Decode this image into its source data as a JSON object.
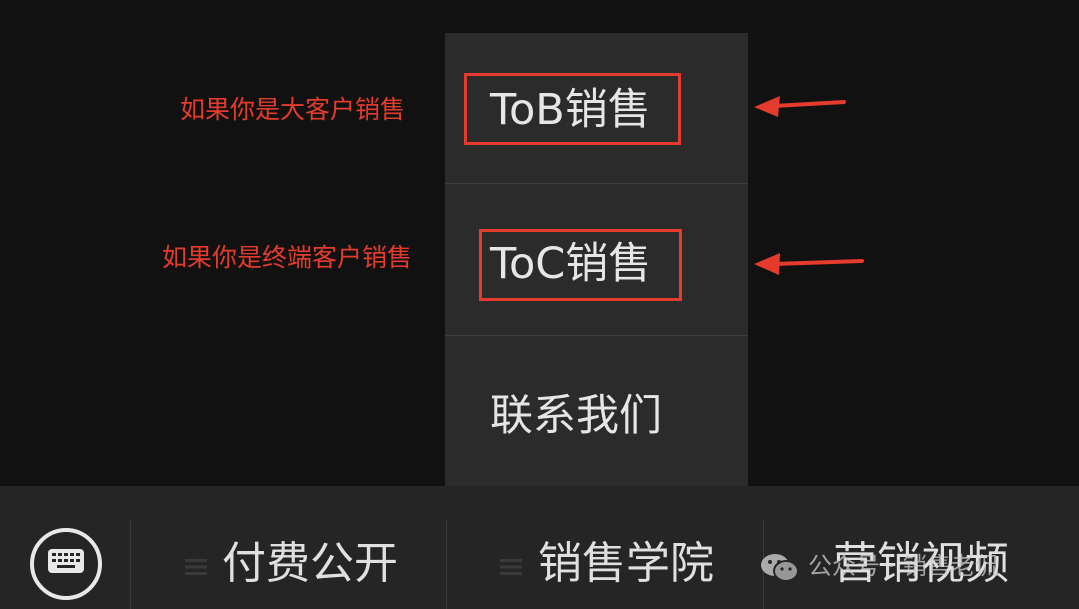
{
  "menu": {
    "items": [
      {
        "label": "ToB销售"
      },
      {
        "label": "ToC销售"
      },
      {
        "label": "联系我们"
      }
    ]
  },
  "annotations": [
    {
      "text": "如果你是大客户销售"
    },
    {
      "text": "如果你是终端客户销售"
    }
  ],
  "bottom_bar": {
    "keyboard_icon": "keyboard-icon",
    "tabs": [
      {
        "label": "付费公开"
      },
      {
        "label": "销售学院"
      },
      {
        "label": "营销视频"
      }
    ]
  },
  "watermark": {
    "text": "公众号 · 销售老侃"
  },
  "colors": {
    "background": "#111111",
    "menu_bg": "#2b2b2b",
    "bottom_bar_bg": "#252525",
    "annotation_red": "#e53b2c",
    "text_light": "#e6e6e6"
  }
}
